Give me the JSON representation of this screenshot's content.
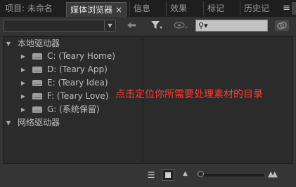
{
  "tabs": [
    {
      "label": "项目: 未命名",
      "active": false
    },
    {
      "label": "媒体浏览器",
      "active": true,
      "close": "×"
    },
    {
      "label": "信息",
      "active": false
    },
    {
      "label": "效果",
      "active": false
    },
    {
      "label": "标记",
      "active": false
    },
    {
      "label": "历史记",
      "active": false
    }
  ],
  "panel_menu_glyph": "≡",
  "toolbar": {
    "path_value": "",
    "icons": [
      "back-arrow-icon",
      "filter-icon",
      "eye-icon",
      "search-icon",
      "link-icon"
    ],
    "search_value": ""
  },
  "tree": {
    "local": {
      "label": "本地驱动器",
      "expanded": true
    },
    "drives": [
      {
        "label": "C: (Teary Home)"
      },
      {
        "label": "D: (Teary App)"
      },
      {
        "label": "E: (Teary Idea)"
      },
      {
        "label": "F: (Teary Love)"
      },
      {
        "label": "G: (系统保留)"
      }
    ],
    "network": {
      "label": "网络驱动器",
      "expanded": true
    }
  },
  "annotation": {
    "text": "点击定位你所需要处理素材的目录",
    "color": "#ff3b30"
  },
  "bottom": {
    "views": [
      "list-view",
      "icon-view"
    ],
    "active_view": "icon-view",
    "zoom_fraction": 0.0
  }
}
